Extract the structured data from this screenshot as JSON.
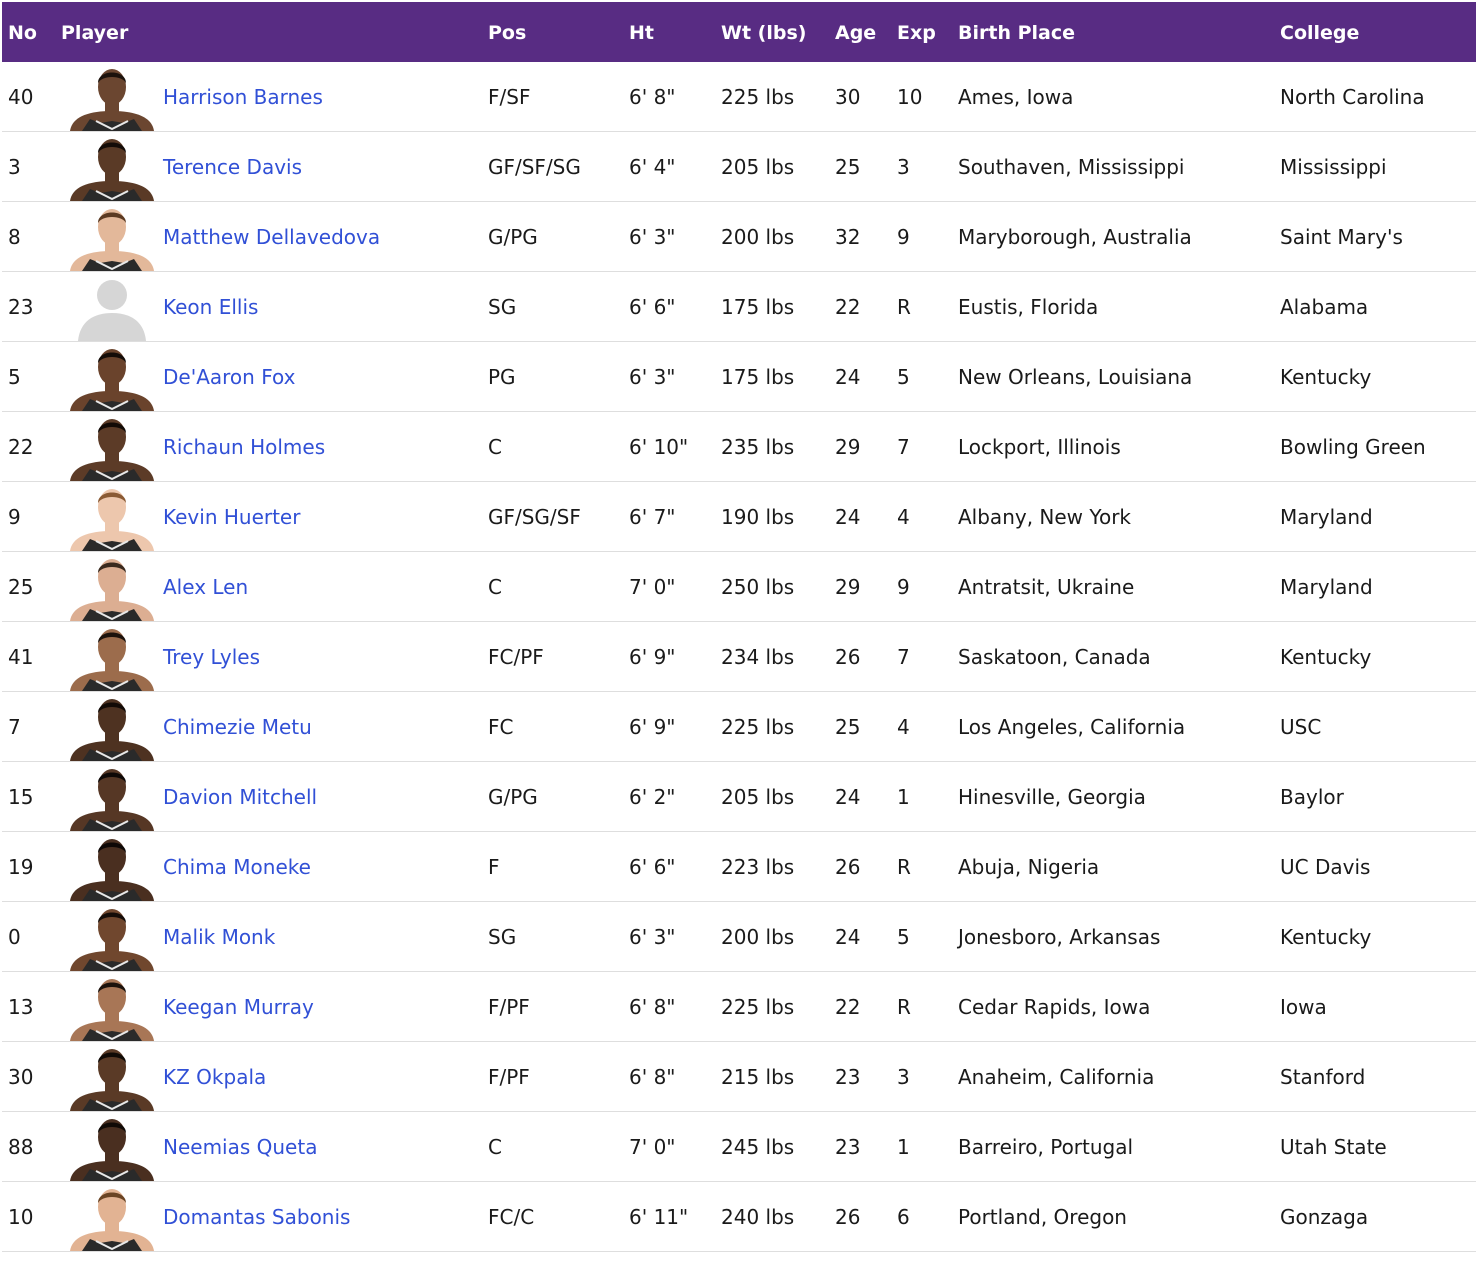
{
  "colors": {
    "header_bg": "#582c83",
    "header_text": "#ffffff",
    "link": "#3150d6",
    "text": "#1a1a1a",
    "divider": "#dedede"
  },
  "table": {
    "headers": {
      "no": "No",
      "player": "Player",
      "pos": "Pos",
      "ht": "Ht",
      "wt": "Wt (lbs)",
      "age": "Age",
      "exp": "Exp",
      "birth_place": "Birth Place",
      "college": "College"
    },
    "rows": [
      {
        "no": "40",
        "name": "Harrison Barnes",
        "pos": "F/SF",
        "ht": "6' 8\"",
        "wt": "225 lbs",
        "age": "30",
        "exp": "10",
        "birth_place": "Ames, Iowa",
        "college": "North Carolina",
        "photo": "player-headshot",
        "skin": "#6b4630",
        "hair": "#1c120c"
      },
      {
        "no": "3",
        "name": "Terence Davis",
        "pos": "GF/SF/SG",
        "ht": "6' 4\"",
        "wt": "205 lbs",
        "age": "25",
        "exp": "3",
        "birth_place": "Southaven, Mississippi",
        "college": "Mississippi",
        "photo": "player-headshot",
        "skin": "#5a3a26",
        "hair": "#140c08"
      },
      {
        "no": "8",
        "name": "Matthew Dellavedova",
        "pos": "G/PG",
        "ht": "6' 3\"",
        "wt": "200 lbs",
        "age": "32",
        "exp": "9",
        "birth_place": "Maryborough, Australia",
        "college": "Saint Mary's",
        "photo": "player-headshot",
        "skin": "#e3b89a",
        "hair": "#5b3a22"
      },
      {
        "no": "23",
        "name": "Keon Ellis",
        "pos": "SG",
        "ht": "6' 6\"",
        "wt": "175 lbs",
        "age": "22",
        "exp": "R",
        "birth_place": "Eustis, Florida",
        "college": "Alabama",
        "photo": "silhouette",
        "skin": "#d9d9d9",
        "hair": "#d9d9d9"
      },
      {
        "no": "5",
        "name": "De'Aaron Fox",
        "pos": "PG",
        "ht": "6' 3\"",
        "wt": "175 lbs",
        "age": "24",
        "exp": "5",
        "birth_place": "New Orleans, Louisiana",
        "college": "Kentucky",
        "photo": "player-headshot",
        "skin": "#6a432c",
        "hair": "#140c08"
      },
      {
        "no": "22",
        "name": "Richaun Holmes",
        "pos": "C",
        "ht": "6' 10\"",
        "wt": "235 lbs",
        "age": "29",
        "exp": "7",
        "birth_place": "Lockport, Illinois",
        "college": "Bowling Green",
        "photo": "player-headshot",
        "skin": "#5c3b27",
        "hair": "#120a06"
      },
      {
        "no": "9",
        "name": "Kevin Huerter",
        "pos": "GF/SG/SF",
        "ht": "6' 7\"",
        "wt": "190 lbs",
        "age": "24",
        "exp": "4",
        "birth_place": "Albany, New York",
        "college": "Maryland",
        "photo": "player-headshot",
        "skin": "#edc7ad",
        "hair": "#8a5a34"
      },
      {
        "no": "25",
        "name": "Alex Len",
        "pos": "C",
        "ht": "7' 0\"",
        "wt": "250 lbs",
        "age": "29",
        "exp": "9",
        "birth_place": "Antratsit, Ukraine",
        "college": "Maryland",
        "photo": "player-headshot",
        "skin": "#dcae92",
        "hair": "#3a2a1e"
      },
      {
        "no": "41",
        "name": "Trey Lyles",
        "pos": "FC/PF",
        "ht": "6' 9\"",
        "wt": "234 lbs",
        "age": "26",
        "exp": "7",
        "birth_place": "Saskatoon, Canada",
        "college": "Kentucky",
        "photo": "player-headshot",
        "skin": "#9c6c4c",
        "hair": "#1c120c"
      },
      {
        "no": "7",
        "name": "Chimezie Metu",
        "pos": "FC",
        "ht": "6' 9\"",
        "wt": "225 lbs",
        "age": "25",
        "exp": "4",
        "birth_place": "Los Angeles, California",
        "college": "USC",
        "photo": "player-headshot",
        "skin": "#4e3221",
        "hair": "#120a06"
      },
      {
        "no": "15",
        "name": "Davion Mitchell",
        "pos": "G/PG",
        "ht": "6' 2\"",
        "wt": "205 lbs",
        "age": "24",
        "exp": "1",
        "birth_place": "Hinesville, Georgia",
        "college": "Baylor",
        "photo": "player-headshot",
        "skin": "#563725",
        "hair": "#0e0806"
      },
      {
        "no": "19",
        "name": "Chima Moneke",
        "pos": "F",
        "ht": "6' 6\"",
        "wt": "223 lbs",
        "age": "26",
        "exp": "R",
        "birth_place": "Abuja, Nigeria",
        "college": "UC Davis",
        "photo": "player-headshot",
        "skin": "#4a2f20",
        "hair": "#0e0806"
      },
      {
        "no": "0",
        "name": "Malik Monk",
        "pos": "SG",
        "ht": "6' 3\"",
        "wt": "200 lbs",
        "age": "24",
        "exp": "5",
        "birth_place": "Jonesboro, Arkansas",
        "college": "Kentucky",
        "photo": "player-headshot",
        "skin": "#70472e",
        "hair": "#140c08"
      },
      {
        "no": "13",
        "name": "Keegan Murray",
        "pos": "F/PF",
        "ht": "6' 8\"",
        "wt": "225 lbs",
        "age": "22",
        "exp": "R",
        "birth_place": "Cedar Rapids, Iowa",
        "college": "Iowa",
        "photo": "player-headshot",
        "skin": "#a87656",
        "hair": "#1c120c"
      },
      {
        "no": "30",
        "name": "KZ Okpala",
        "pos": "F/PF",
        "ht": "6' 8\"",
        "wt": "215 lbs",
        "age": "23",
        "exp": "3",
        "birth_place": "Anaheim, California",
        "college": "Stanford",
        "photo": "player-headshot",
        "skin": "#5a3a26",
        "hair": "#100a06"
      },
      {
        "no": "88",
        "name": "Neemias Queta",
        "pos": "C",
        "ht": "7' 0\"",
        "wt": "245 lbs",
        "age": "23",
        "exp": "1",
        "birth_place": "Barreiro, Portugal",
        "college": "Utah State",
        "photo": "player-headshot",
        "skin": "#4a2f20",
        "hair": "#100a06"
      },
      {
        "no": "10",
        "name": "Domantas Sabonis",
        "pos": "FC/C",
        "ht": "6' 11\"",
        "wt": "240 lbs",
        "age": "26",
        "exp": "6",
        "birth_place": "Portland, Oregon",
        "college": "Gonzaga",
        "photo": "player-headshot",
        "skin": "#e2b393",
        "hair": "#6a4424"
      }
    ]
  }
}
